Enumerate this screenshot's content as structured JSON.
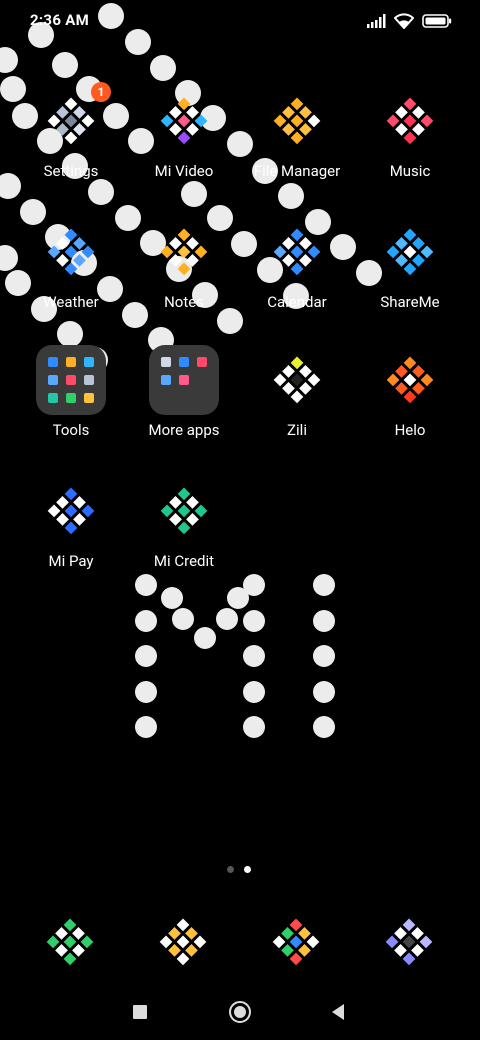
{
  "status_bar": {
    "time": "2:36 AM",
    "icons": [
      "signal-icon",
      "wifi-icon",
      "battery-icon"
    ]
  },
  "apps": [
    {
      "label": "Settings",
      "icon": "settings-icon",
      "badge": "1"
    },
    {
      "label": "Mi Video",
      "icon": "mi-video-icon"
    },
    {
      "label": "File Manager",
      "icon": "file-manager-icon"
    },
    {
      "label": "Music",
      "icon": "music-icon"
    },
    {
      "label": "Weather",
      "icon": "weather-icon"
    },
    {
      "label": "Notes",
      "icon": "notes-icon"
    },
    {
      "label": "Calendar",
      "icon": "calendar-icon"
    },
    {
      "label": "ShareMe",
      "icon": "shareme-icon"
    },
    {
      "label": "Tools",
      "icon": "folder-icon"
    },
    {
      "label": "More apps",
      "icon": "folder-icon"
    },
    {
      "label": "Zili",
      "icon": "zili-icon"
    },
    {
      "label": "Helo",
      "icon": "helo-icon"
    },
    {
      "label": "Mi Pay",
      "icon": "mi-pay-icon"
    },
    {
      "label": "Mi Credit",
      "icon": "mi-credit-icon"
    }
  ],
  "dock": [
    {
      "icon": "phone-icon"
    },
    {
      "icon": "messages-icon"
    },
    {
      "icon": "browser-icon"
    },
    {
      "icon": "camera-icon"
    }
  ],
  "pager": {
    "pages": 2,
    "active": 2
  },
  "nav": [
    "recents-button",
    "home-button",
    "back-button"
  ],
  "colors": {
    "background": "#000000",
    "badge": "#ff5a1f",
    "folder": "#3a3a3a",
    "dot": "#ececec"
  }
}
